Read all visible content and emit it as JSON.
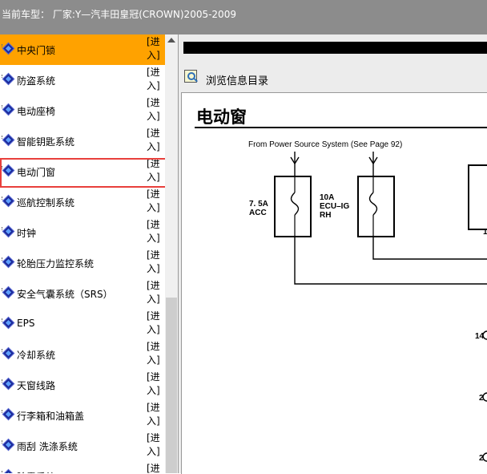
{
  "header": {
    "title": "当前车型： 厂家:Y—汽丰田皇冠(CROWN)2005-2009"
  },
  "sidebar": {
    "items": [
      {
        "label": "中央门锁",
        "enter": "[进入]"
      },
      {
        "label": "防盗系统",
        "enter": "[进入]"
      },
      {
        "label": "电动座椅",
        "enter": "[进入]"
      },
      {
        "label": "智能钥匙系统",
        "enter": "[进入]"
      },
      {
        "label": "电动门窗",
        "enter": "[进入]"
      },
      {
        "label": "巡航控制系统",
        "enter": "[进入]"
      },
      {
        "label": "时钟",
        "enter": "[进入]"
      },
      {
        "label": "轮胎压力监控系统",
        "enter": "[进入]"
      },
      {
        "label": "安全气囊系统（SRS）",
        "enter": "[进入]"
      },
      {
        "label": "EPS",
        "enter": "[进入]"
      },
      {
        "label": "冷却系统",
        "enter": "[进入]"
      },
      {
        "label": "天窗线路",
        "enter": "[进入]"
      },
      {
        "label": "行李箱和油箱盖",
        "enter": "[进入]"
      },
      {
        "label": "雨刮 洗涤系统",
        "enter": "[进入]"
      },
      {
        "label": "除雾系统",
        "enter": "[进入]"
      }
    ],
    "active_index": 0,
    "selected_index": 4
  },
  "viewer": {
    "toolbar_label": "浏览信息目录",
    "doc_title": "电动窗",
    "diagram": {
      "source_text": "From Power Source System (See Page 92)",
      "fuse1_amp": "7. 5A",
      "fuse1_name": "ACC",
      "fuse2_amp": "10A",
      "fuse2_name1": "ECU–IG",
      "fuse2_name2": "RH",
      "pin_a": "14",
      "pin_b": "2",
      "pin_c": "2",
      "partial_a": "1"
    }
  },
  "colors": {
    "header_bg": "#8c8c8c",
    "active_item_bg": "#ffa200",
    "selection_border": "#e8403c",
    "bullet_icon": "#1b2a99"
  }
}
